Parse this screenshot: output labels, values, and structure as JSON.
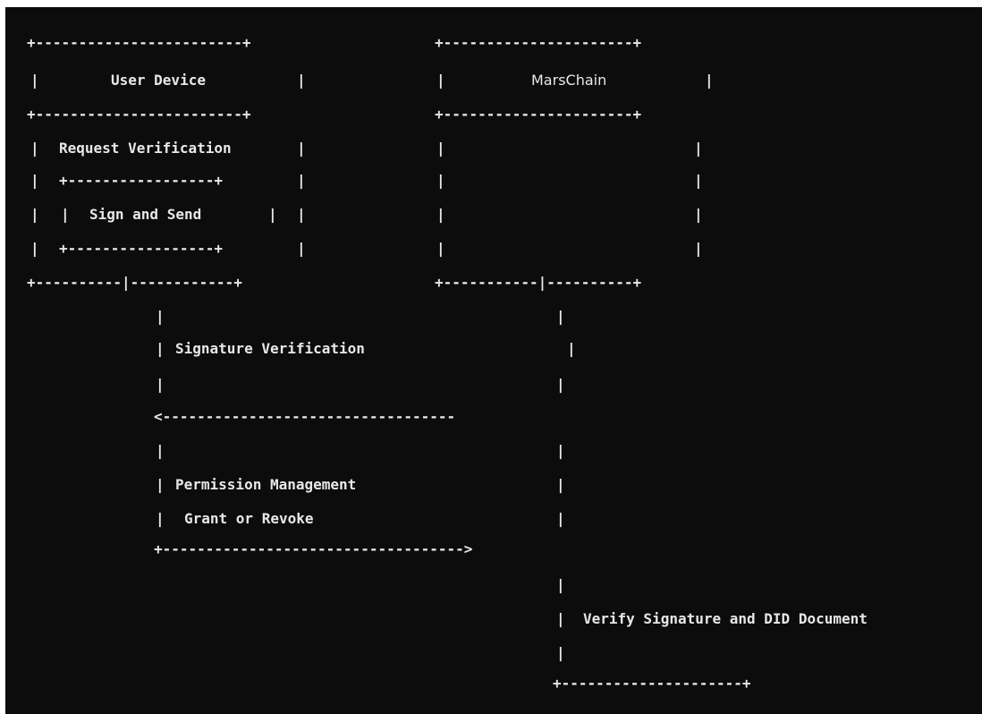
{
  "diagram": {
    "user_device_box": {
      "title": "User Device",
      "step_label": "Request Verification",
      "inner_box_label": "Sign and Send"
    },
    "marschain_box": {
      "title": "MarsChain"
    },
    "messages": [
      {
        "label": "Signature Verification",
        "direction": "to-user-device"
      },
      {
        "label_line1": "Permission Management",
        "label_line2": "Grant or Revoke",
        "direction": "to-marschain"
      }
    ],
    "final_step": {
      "label": "Verify Signature and DID Document"
    },
    "ascii_art": {
      "h_border_top": "+------------------------+",
      "h_border_mc_top": "+----------------------+",
      "h_border_split_left": "+----------|------------+",
      "h_border_split_right": "+-----------|----------+",
      "inner_h": "+-----------------+",
      "arrow_left": "<----------------------------------",
      "arrow_right": "+----------------------------------->",
      "final_line": "+---------------------+",
      "pipe": "|"
    }
  }
}
